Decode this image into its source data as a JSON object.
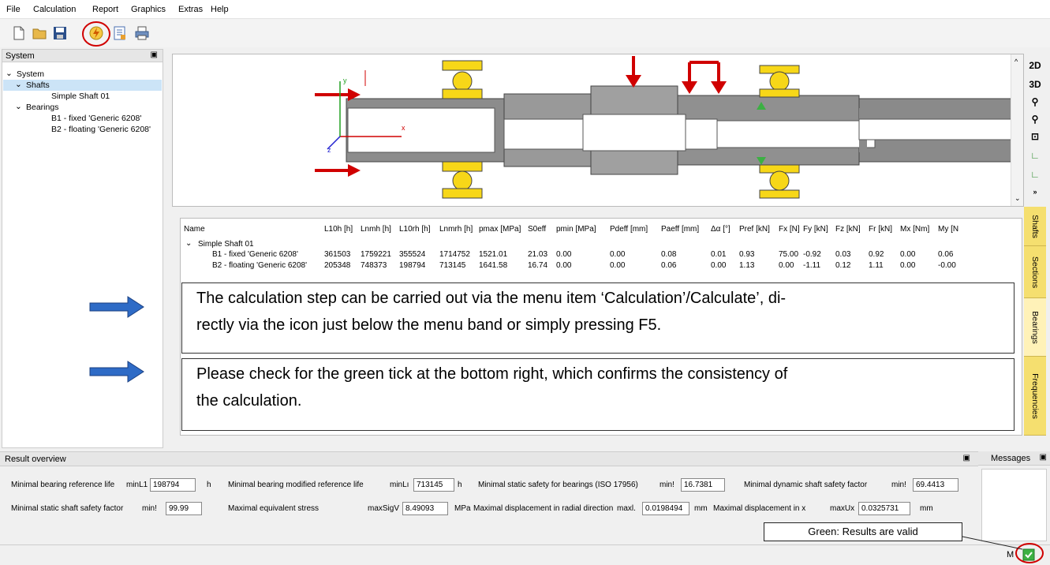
{
  "menu": [
    "File",
    "Calculation",
    "Report",
    "Graphics",
    "Extras",
    "Help"
  ],
  "toolbar": {
    "icons": [
      "new-file-icon",
      "open-folder-icon",
      "save-icon",
      "calculate-icon",
      "report-icon",
      "print-icon"
    ]
  },
  "system_panel": {
    "title": "System",
    "tree": {
      "root": "System",
      "shafts": "Shafts",
      "shaft1": "Simple Shaft 01",
      "bearings": "Bearings",
      "b1": "B1 - fixed 'Generic 6208'",
      "b2": "B2 - floating 'Generic 6208'"
    }
  },
  "view_buttons": [
    "2D",
    "3D"
  ],
  "view_labels": {
    "y": "y",
    "x": "x",
    "z": "z",
    "yg": "y",
    "g": "g"
  },
  "side_tabs": [
    "Shafts",
    "Sections",
    "Bearings",
    "Frequencies"
  ],
  "table": {
    "headers": [
      "Name",
      "L10h [h]",
      "Lnmh [h]",
      "L10rh [h]",
      "Lnmrh [h]",
      "pmax [MPa]",
      "S0eff",
      "pmin [MPa]",
      "Pdeff [mm]",
      "Paeff [mm]",
      "Δα [°]",
      "Pref [kN]",
      "Fx [N]",
      "Fy [kN]",
      "Fz [kN]",
      "Fr [kN]",
      "Mx [Nm]",
      "My [N"
    ],
    "group": "Simple Shaft 01",
    "rows": [
      [
        "B1 - fixed 'Generic 6208'",
        "361503",
        "1759221",
        "355524",
        "1714752",
        "1521.01",
        "21.03",
        "0.00",
        "0.00",
        "0.08",
        "0.01",
        "0.93",
        "75.00",
        "-0.92",
        "0.03",
        "0.92",
        "0.00",
        "0.06"
      ],
      [
        "B2 - floating 'Generic 6208'",
        "205348",
        "748373",
        "198794",
        "713145",
        "1641.58",
        "16.74",
        "0.00",
        "0.00",
        "0.06",
        "0.00",
        "1.13",
        "0.00",
        "-1.11",
        "0.12",
        "1.11",
        "0.00",
        "-0.00"
      ]
    ]
  },
  "notes": [
    {
      "line1": "The calculation step can be carried out via the menu item ‘Calculation’/Calculate’, di-",
      "line2": "rectly via the icon just below the menu band or simply pressing F5."
    },
    {
      "line1": "Please check for the green tick at the bottom right, which confirms the consistency of",
      "line2": "the calculation."
    }
  ],
  "result_overview": {
    "title": "Result overview",
    "row1": [
      {
        "label": "Minimal bearing reference life",
        "sym": "minL1",
        "value": "198794",
        "unit": "h"
      },
      {
        "label": "Minimal bearing modified reference life",
        "sym": "minLı",
        "value": "713145",
        "unit": "h"
      },
      {
        "label": "Minimal static safety for bearings (ISO 17956)",
        "sym": "min!",
        "value": "16.7381",
        "unit": ""
      },
      {
        "label": "Minimal dynamic shaft safety factor",
        "sym": "min!",
        "value": "69.4413",
        "unit": ""
      }
    ],
    "row2": [
      {
        "label": "Minimal static shaft safety factor",
        "sym": "min!",
        "value": "99.99",
        "unit": ""
      },
      {
        "label": "Maximal equivalent stress",
        "sym": "maxSigV",
        "value": "8.49093",
        "unit": "MPa"
      },
      {
        "label": "Maximal displacement in radial direction",
        "sym": "maxl.",
        "value": "0.0198494",
        "unit": "mm"
      },
      {
        "label": "Maximal displacement in x",
        "sym": "maxUx",
        "value": "0.0325731",
        "unit": "mm"
      }
    ]
  },
  "messages": {
    "title": "Messages"
  },
  "status": {
    "label": "M",
    "callout": "Green: Results are valid"
  },
  "colors": {
    "accent_red": "#d00000",
    "tab_yellow": "#f5df6f",
    "bearing_yellow": "#f7d718",
    "arrow_blue": "#2e6bc6",
    "tick_green": "#3cb043"
  }
}
